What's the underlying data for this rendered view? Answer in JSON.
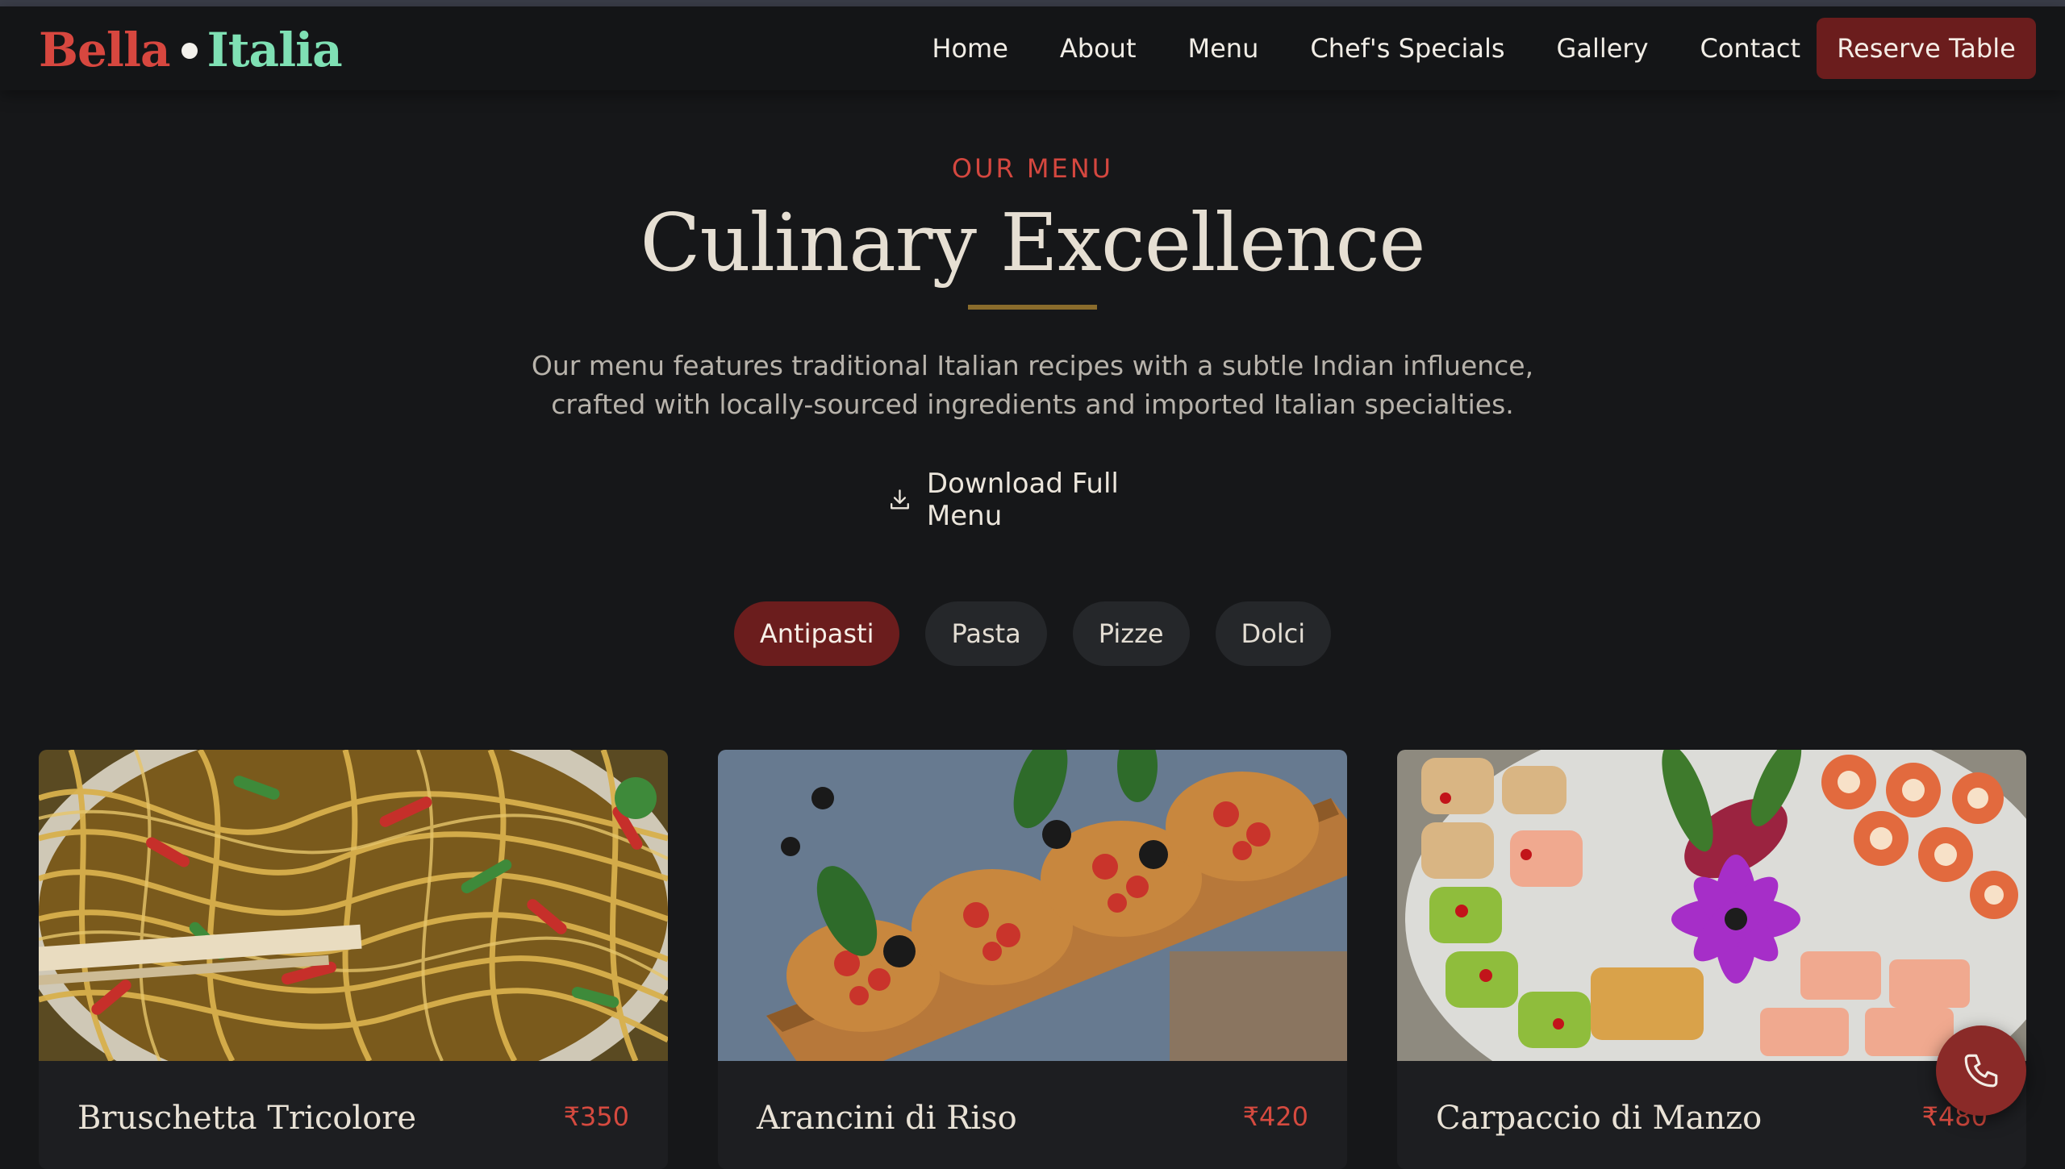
{
  "brand": {
    "word1": "Bella",
    "word2": "Italia"
  },
  "nav": {
    "items": [
      {
        "label": "Home"
      },
      {
        "label": "About"
      },
      {
        "label": "Menu"
      },
      {
        "label": "Chef's Specials"
      },
      {
        "label": "Gallery"
      },
      {
        "label": "Contact"
      }
    ],
    "cta": "Reserve Table"
  },
  "menu_section": {
    "eyebrow": "OUR MENU",
    "title": "Culinary Excellence",
    "intro": "Our menu features traditional Italian recipes with a subtle Indian influence, crafted with locally-sourced ingredients and imported Italian specialties.",
    "download_label": "Download Full Menu",
    "download_icon": "download-icon"
  },
  "tabs": [
    {
      "label": "Antipasti",
      "active": true
    },
    {
      "label": "Pasta",
      "active": false
    },
    {
      "label": "Pizze",
      "active": false
    },
    {
      "label": "Dolci",
      "active": false
    }
  ],
  "cards": [
    {
      "title": "Bruschetta Tricolore",
      "price": "₹350"
    },
    {
      "title": "Arancini di Riso",
      "price": "₹420"
    },
    {
      "title": "Carpaccio di Manzo",
      "price": "₹480"
    }
  ],
  "floating": {
    "icon": "phone-icon"
  },
  "colors": {
    "background": "#161719",
    "accent_red": "#d4473f",
    "button_maroon": "#6b1d1d",
    "brand_mint": "#7fe0b4",
    "divider_gold": "#8a6c2c"
  }
}
